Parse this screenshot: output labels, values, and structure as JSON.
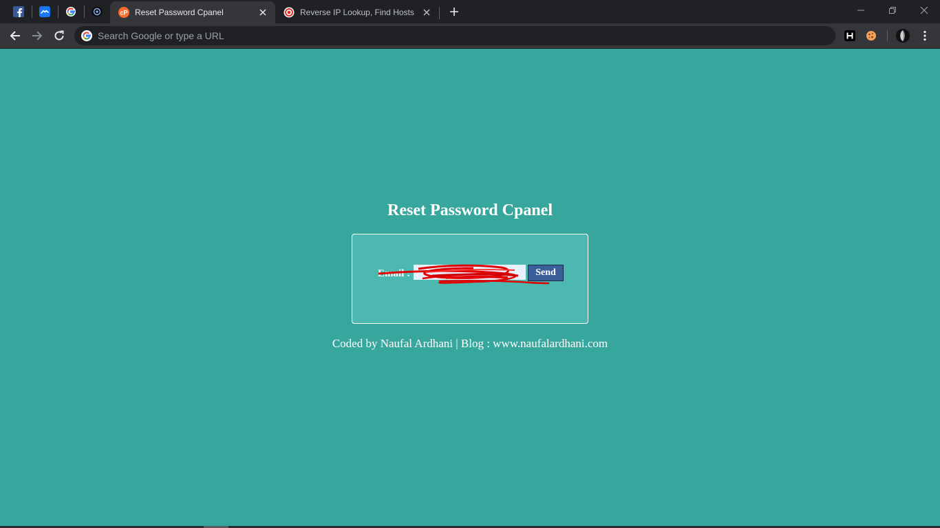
{
  "browser": {
    "pinned_tabs": [
      {
        "name": "facebook",
        "icon": "facebook-icon",
        "color": "#3b5998"
      },
      {
        "name": "messenger",
        "icon": "messenger-icon",
        "color": "#1877f2"
      },
      {
        "name": "google",
        "icon": "google-icon"
      },
      {
        "name": "dark-app",
        "icon": "gear-circle-icon"
      }
    ],
    "tabs": [
      {
        "title": "Reset Password Cpanel",
        "icon": "cpanel-icon",
        "active": true,
        "icon_color": "#ff6c2c"
      },
      {
        "title": "Reverse IP Lookup, Find Hosts Sh",
        "icon": "target-icon",
        "active": false,
        "icon_color": "#d93025"
      }
    ],
    "omnibox": {
      "placeholder": "Search Google or type a URL",
      "value": ""
    },
    "extensions": [
      {
        "icon": "h-extension-icon"
      },
      {
        "icon": "cookie-extension-icon"
      },
      {
        "icon": "profile-avatar-icon"
      },
      {
        "icon": "more-menu-icon"
      }
    ]
  },
  "page": {
    "heading": "Reset Password Cpanel",
    "form": {
      "email_label": "Email :",
      "email_value": "",
      "send_label": "Send"
    },
    "footer": "Coded by Naufal Ardhani | Blog : www.naufalardhani.com"
  },
  "colors": {
    "page_background": "#37a69c",
    "card_background": "#4cb8b0",
    "send_button": "#3b5f9a",
    "redaction": "#e00000"
  }
}
